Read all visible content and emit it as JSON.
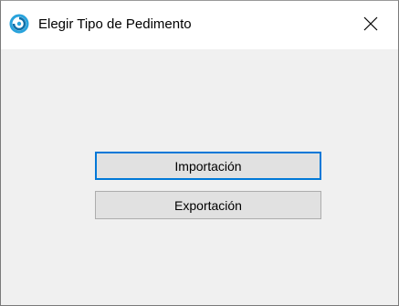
{
  "window": {
    "title": "Elegir Tipo de Pedimento",
    "close_icon": "close-icon",
    "app_icon": "app-swirl-icon"
  },
  "buttons": {
    "import_label": "Importación",
    "export_label": "Exportación"
  },
  "colors": {
    "focus_border": "#0078d7",
    "button_face": "#e1e1e1",
    "client_background": "#f0f0f0",
    "app_icon_primary": "#29a3dc"
  }
}
